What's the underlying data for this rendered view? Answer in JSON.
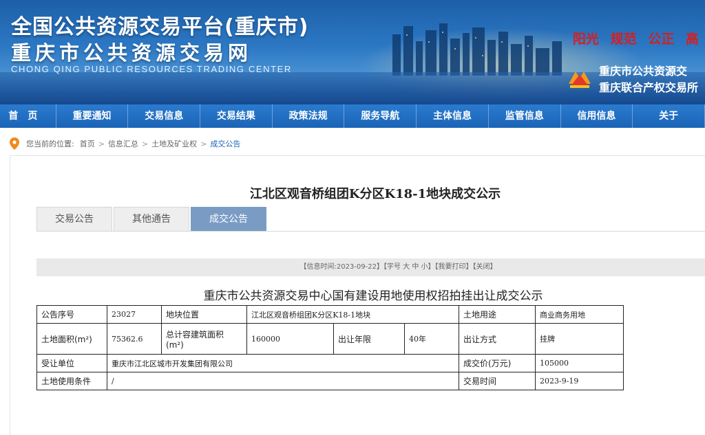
{
  "header": {
    "title_cn": "全国公共资源交易平台(重庆市)",
    "title_cn2": "重庆市公共资源交易网",
    "title_en": "CHONG QING PUBLIC RESOURCES TRADING CENTER",
    "slogan": [
      "阳光",
      "规范",
      "公正",
      "高"
    ],
    "org_line1": "重庆市公共资源交",
    "org_line2": "重庆联合产权交易所"
  },
  "nav": {
    "items": [
      "首页",
      "重要通知",
      "交易信息",
      "交易结果",
      "政策法规",
      "服务导航",
      "主体信息",
      "监管信息",
      "信用信息",
      "关于"
    ]
  },
  "breadcrumb": {
    "prefix": "您当前的位置:",
    "items": [
      "首页",
      "信息汇总",
      "土地及矿业权",
      "成交公告"
    ]
  },
  "page": {
    "title": "江北区观音桥组团K分区K18-1地块成交公示",
    "tabs": [
      "交易公告",
      "其他通告",
      "成交公告"
    ],
    "active_tab": 2,
    "info_bar": "【信息时间:2023-09-22】【字号 大 中 小】【我要打印】【关闭】",
    "doc_title": "重庆市公共资源交易中心国有建设用地使用权招拍挂出让成交公示"
  },
  "table": {
    "row1": {
      "k1": "公告序号",
      "v1": "23027",
      "k2": "地块位置",
      "v2": "江北区观音桥组团K分区K18-1地块",
      "k3": "土地用途",
      "v3": "商业商务用地"
    },
    "row2": {
      "k1": "土地面积(m²)",
      "v1": "75362.6",
      "k2a": "总计容建筑面积",
      "k2b": "(m²)",
      "v2": "160000",
      "k3": "出让年限",
      "v3": "40年",
      "k4": "出让方式",
      "v4": "挂牌"
    },
    "row3": {
      "k1": "受让单位",
      "v1": "重庆市江北区城市开发集团有限公司",
      "k2": "成交价(万元)",
      "v2": "105000"
    },
    "row4": {
      "k1": "土地使用条件",
      "v1": "/",
      "k2": "交易时间",
      "v2": "2023-9-19"
    }
  },
  "colors": {
    "nav_bg": "#1a64b6",
    "active_tab": "#7a9cc4",
    "slogan": "#d81e1e",
    "link": "#1a64b6"
  }
}
